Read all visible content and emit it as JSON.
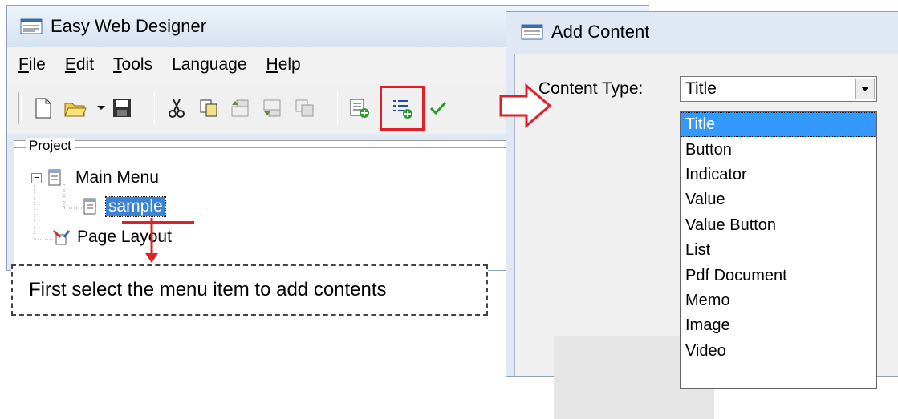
{
  "main_window": {
    "title": "Easy Web Designer",
    "menu": [
      {
        "mnemonic": "F",
        "rest": "ile"
      },
      {
        "mnemonic": "E",
        "rest": "dit"
      },
      {
        "mnemonic": "T",
        "rest": "ools"
      },
      {
        "mnemonic": "",
        "rest": "Language"
      },
      {
        "mnemonic": "H",
        "rest": "elp"
      }
    ],
    "panel_label": "Project",
    "tree": {
      "root": "Main Menu",
      "child": "sample",
      "sibling": "Page Layout"
    }
  },
  "annotation": {
    "note": "First select the menu item to add contents",
    "highlight_color": "#e02026"
  },
  "dialog": {
    "title": "Add Content",
    "field_label": "Content Type:",
    "selected": "Title",
    "options": [
      "Title",
      "Button",
      "Indicator",
      "Value",
      "Value Button",
      "List",
      "Pdf Document",
      "Memo",
      "Image",
      "Video"
    ]
  }
}
